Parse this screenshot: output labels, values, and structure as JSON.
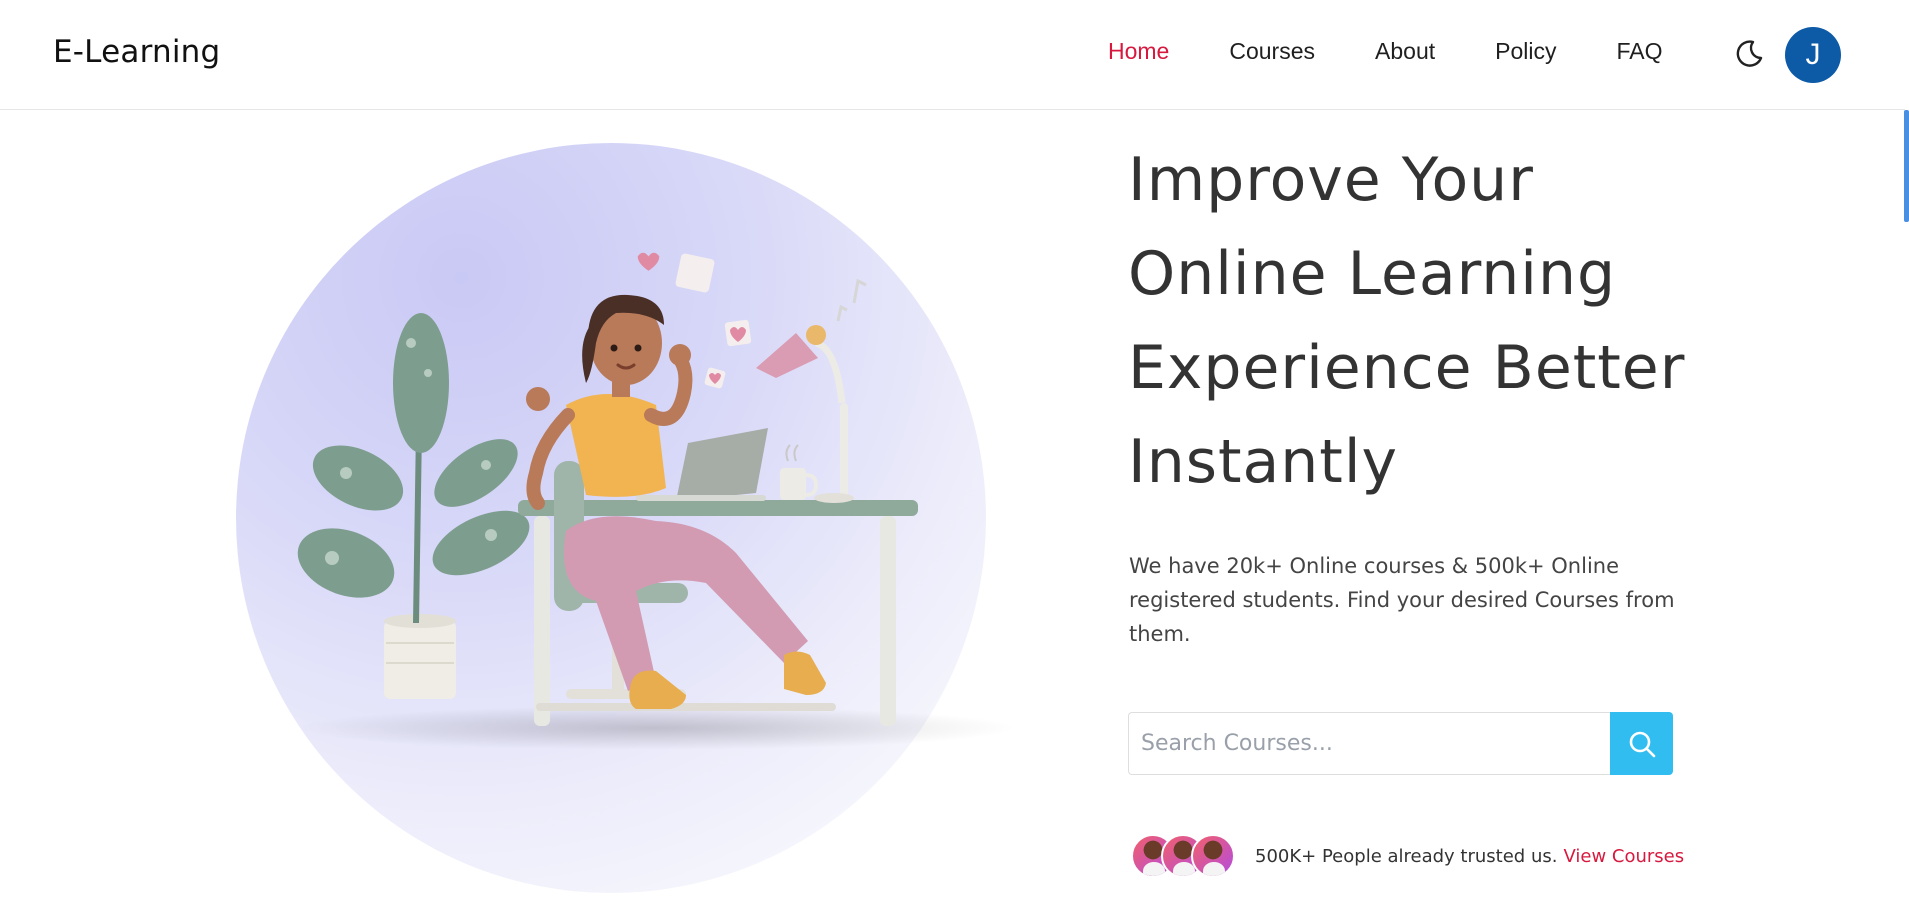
{
  "header": {
    "brand": "E-Learning",
    "nav": [
      {
        "label": "Home",
        "active": true
      },
      {
        "label": "Courses",
        "active": false
      },
      {
        "label": "About",
        "active": false
      },
      {
        "label": "Policy",
        "active": false
      },
      {
        "label": "FAQ",
        "active": false
      }
    ],
    "theme_icon": "moon-icon",
    "avatar_initial": "J",
    "avatar_color": "#0d5aa7",
    "active_color": "#d7193f"
  },
  "hero": {
    "title_lines": [
      "Improve Your",
      "Online Learning",
      "Experience Better",
      "Instantly"
    ],
    "description": "We have 20k+ Online courses & 500k+ Online registered students. Find your desired Courses from them.",
    "search": {
      "placeholder": "Search Courses...",
      "value": "",
      "button_icon": "search-icon",
      "button_color": "#32bdf0"
    },
    "trust": {
      "text": "500K+ People already trusted us.",
      "link": "View Courses"
    },
    "illustration_icon": "student-at-desk-illustration"
  }
}
